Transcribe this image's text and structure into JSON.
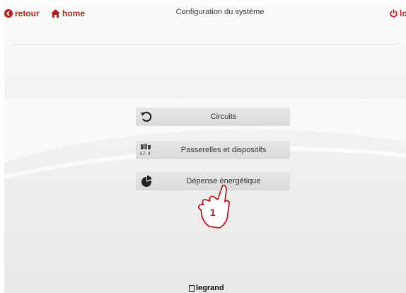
{
  "nav": {
    "back_label": "retour",
    "home_label": "home",
    "logout_label": "logou"
  },
  "header": {
    "title": "Configuration du système"
  },
  "menu": {
    "items": [
      {
        "label": "Circuits",
        "icon": "circular-arrow-icon"
      },
      {
        "label": "Passerelles et dispositifs",
        "icon": "gateway-device-icon"
      },
      {
        "label": "Dépense énergétique",
        "icon": "pie-chart-icon"
      }
    ]
  },
  "device_icon_text": "67.4",
  "annotation": {
    "step": "1"
  },
  "brand": {
    "logo_text": "legrand"
  },
  "colors": {
    "accent": "#b01e1e",
    "button_bg": "#e0dedc",
    "text": "#333333"
  }
}
